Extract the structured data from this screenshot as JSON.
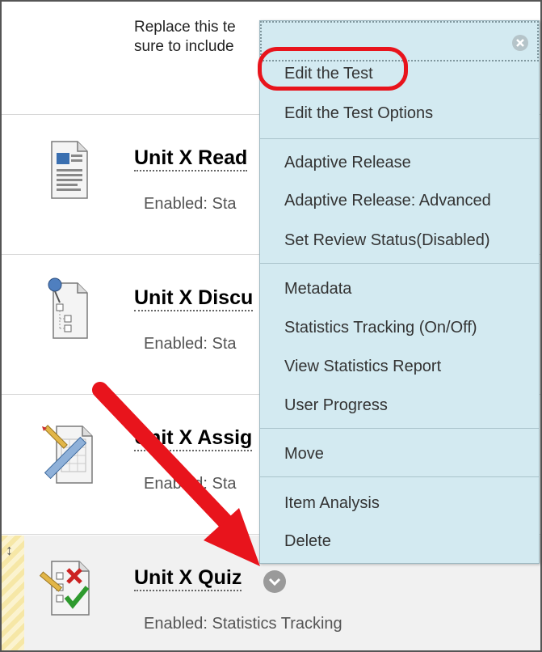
{
  "intro_text": "Replace this te\nsure to include",
  "items": [
    {
      "title": "Unit X Read",
      "status": "Enabled:  Sta",
      "icon": "document-icon"
    },
    {
      "title": "Unit X Discu",
      "status": "Enabled:  Sta",
      "icon": "discussion-icon"
    },
    {
      "title": "Unit X Assig",
      "status": "Enabled:  Sta",
      "icon": "assignment-icon"
    },
    {
      "title": "Unit X Quiz",
      "status": "Enabled:  Statistics Tracking",
      "icon": "quiz-icon"
    }
  ],
  "menu": {
    "items": [
      "Edit the Test",
      "Edit the Test Options",
      "Adaptive Release",
      "Adaptive Release: Advanced",
      "Set Review Status(Disabled)",
      "Metadata",
      "Statistics Tracking (On/Off)",
      "View Statistics Report",
      "User Progress",
      "Move",
      "Item Analysis",
      "Delete"
    ]
  },
  "colors": {
    "menu_bg": "#d3eaf1",
    "highlight": "#e8141c",
    "arrow": "#e8141c"
  }
}
